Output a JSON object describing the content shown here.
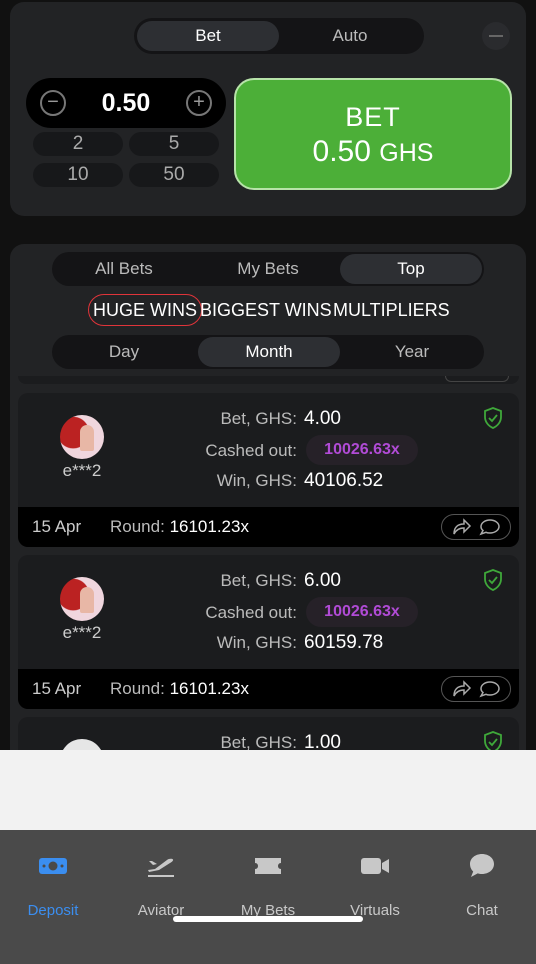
{
  "bet_panel": {
    "tabs": [
      "Bet",
      "Auto"
    ],
    "active_tab": "Bet",
    "amount": "0.50",
    "quick_amounts": [
      "2",
      "5",
      "10",
      "50"
    ],
    "bet_button": {
      "label": "BET",
      "amount": "0.50",
      "currency": "GHS"
    },
    "accent_color": "#4caf38"
  },
  "bets_panel": {
    "tabs": [
      "All Bets",
      "My Bets",
      "Top"
    ],
    "active_tab": "Top",
    "categories": [
      "HUGE WINS",
      "BIGGEST WINS",
      "MULTIPLIERS"
    ],
    "active_category": "HUGE WINS",
    "periods": [
      "Day",
      "Month",
      "Year"
    ],
    "active_period": "Month",
    "labels": {
      "bet": "Bet, GHS:",
      "cashed_out": "Cashed out:",
      "win": "Win, GHS:",
      "round": "Round:"
    },
    "entries": [
      {
        "user": "e***2",
        "bet": "4.00",
        "cashed_out": "10026.63x",
        "win": "40106.52",
        "date": "15 Apr",
        "round": "16101.23x"
      },
      {
        "user": "e***2",
        "bet": "6.00",
        "cashed_out": "10026.63x",
        "win": "60159.78",
        "date": "15 Apr",
        "round": "16101.23x"
      },
      {
        "bet": "1.00"
      }
    ]
  },
  "bottom_nav": {
    "items": [
      {
        "label": "Deposit",
        "icon": "banknote-icon",
        "active": true
      },
      {
        "label": "Aviator",
        "icon": "airplane-icon"
      },
      {
        "label": "My Bets",
        "icon": "ticket-icon"
      },
      {
        "label": "Virtuals",
        "icon": "video-camera-icon"
      },
      {
        "label": "Chat",
        "icon": "chat-bubble-icon"
      }
    ],
    "active_color": "#3b8ef0"
  }
}
